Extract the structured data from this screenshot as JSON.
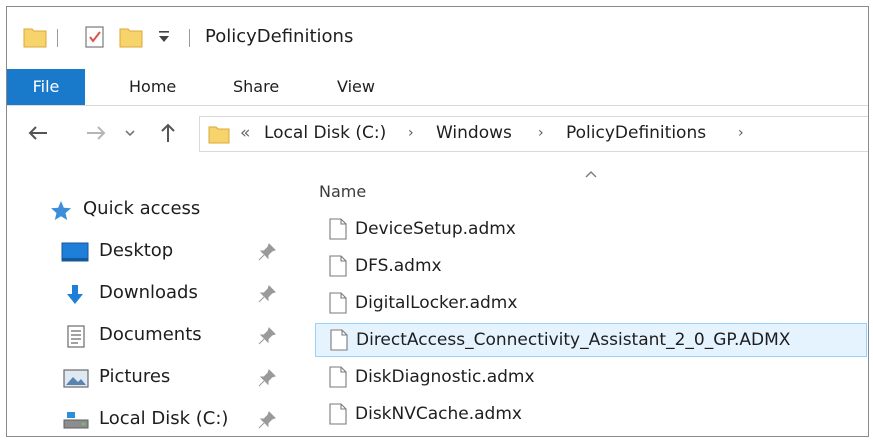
{
  "window": {
    "title": "PolicyDefinitions"
  },
  "ribbon": {
    "tabs": [
      {
        "label": "File",
        "active": true
      },
      {
        "label": "Home"
      },
      {
        "label": "Share"
      },
      {
        "label": "View"
      }
    ]
  },
  "address": {
    "overflow": "«",
    "crumbs": [
      "Local Disk (C:)",
      "Windows",
      "PolicyDefinitions"
    ],
    "separator": "›"
  },
  "nav": {
    "items": [
      {
        "label": "Quick access",
        "icon": "star-icon"
      },
      {
        "label": "Desktop",
        "icon": "desktop-icon",
        "pinned": true
      },
      {
        "label": "Downloads",
        "icon": "download-arrow-icon",
        "pinned": true
      },
      {
        "label": "Documents",
        "icon": "documents-icon",
        "pinned": true
      },
      {
        "label": "Pictures",
        "icon": "pictures-icon",
        "pinned": true
      },
      {
        "label": "Local Disk (C:)",
        "icon": "drive-icon",
        "pinned": true
      }
    ]
  },
  "files": {
    "column_header": "Name",
    "items": [
      {
        "name": "DeviceSetup.admx"
      },
      {
        "name": "DFS.admx"
      },
      {
        "name": "DigitalLocker.admx"
      },
      {
        "name": "DirectAccess_Connectivity_Assistant_2_0_GP.ADMX",
        "selected": true
      },
      {
        "name": "DiskDiagnostic.admx"
      },
      {
        "name": "DiskNVCache.admx"
      }
    ]
  },
  "colors": {
    "accent": "#1979ca",
    "selection_bg": "#e5f3ff",
    "selection_border": "#99d1ff",
    "folder": "#f7d36b"
  }
}
